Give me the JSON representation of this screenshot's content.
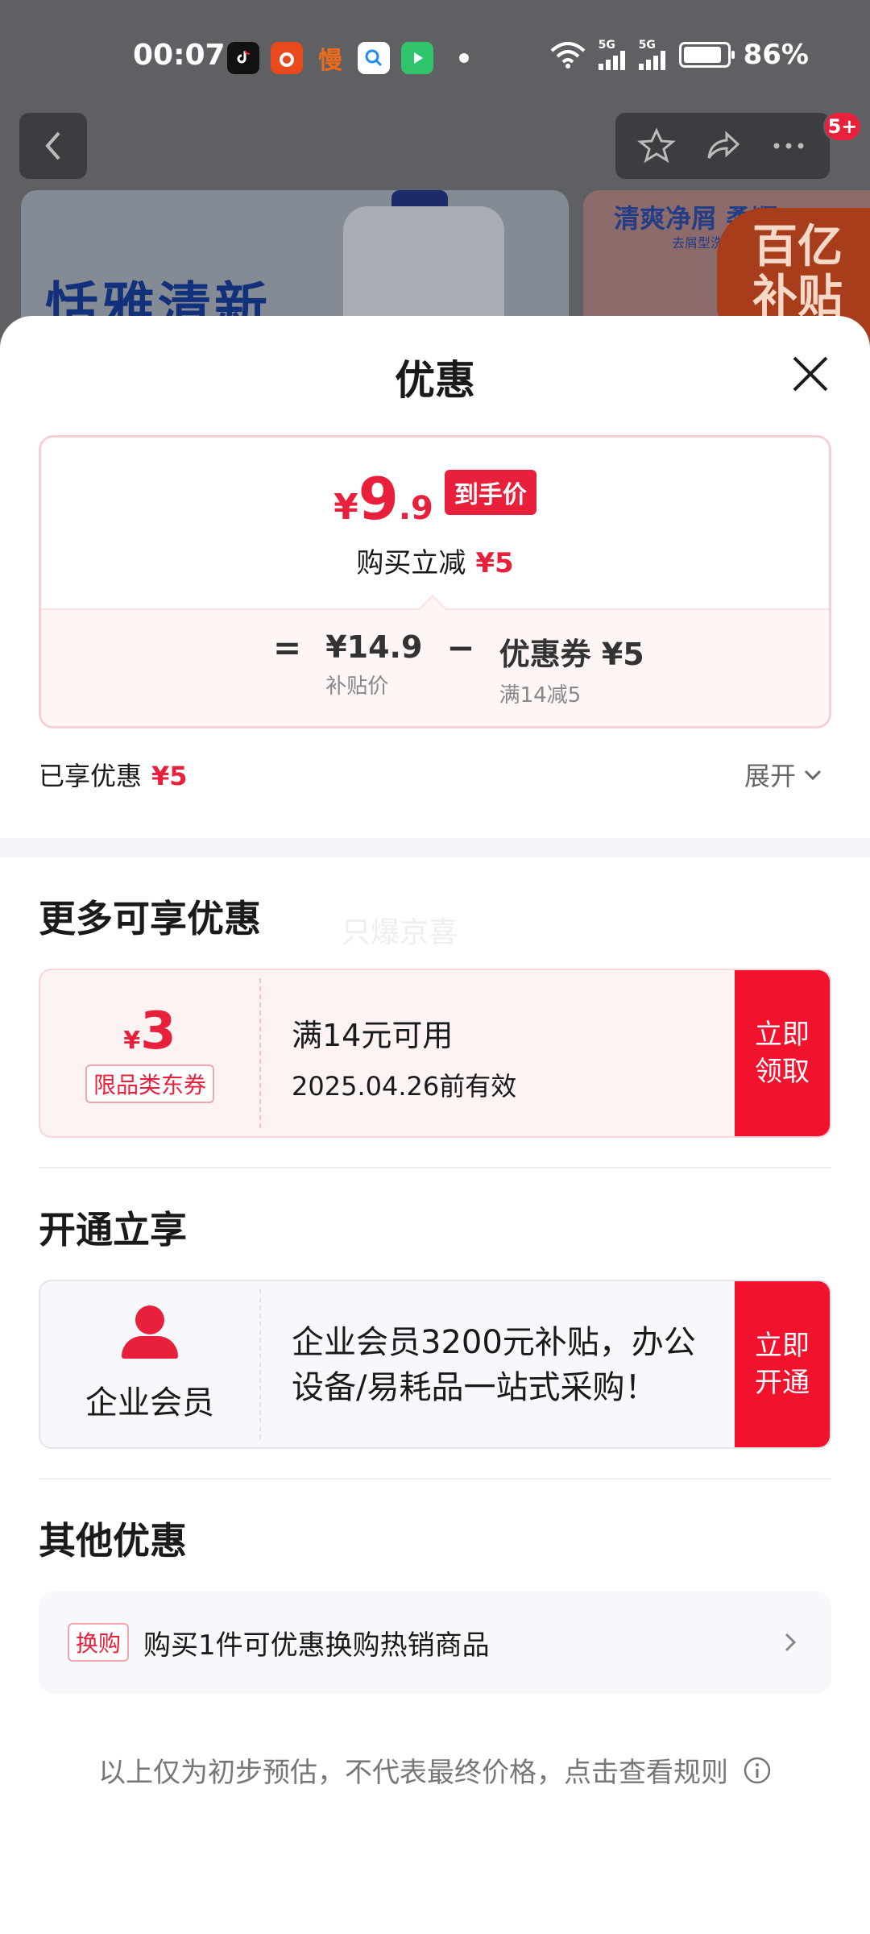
{
  "status_bar": {
    "time": "00:07",
    "battery_percent": "86%",
    "signal_1": "5G",
    "signal_2": "5G",
    "apps": [
      "tiktok-app-icon",
      "shopping-app-icon",
      "slow-app-icon",
      "search-app-icon",
      "video-app-icon"
    ],
    "slow_app_glyph": "慢"
  },
  "background_page": {
    "banner_left_text": "恬雅清新",
    "banner_right_text": "清爽净屑 柔顺",
    "banner_right_sub": "去屑型洗",
    "subsidy_badge_line1": "百亿",
    "subsidy_badge_line2": "补贴",
    "nav_badge": "5+"
  },
  "sheet": {
    "title": "优惠",
    "final_price": {
      "yen": "¥",
      "integer": "9",
      "decimal": ".9",
      "tag": "到手价"
    },
    "instant_discount": {
      "label": "购买立减",
      "value": "¥5"
    },
    "formula": {
      "equals": "=",
      "minus": "−",
      "subsidy_price": "¥14.9",
      "subsidy_price_label": "补贴价",
      "coupon_value": "优惠券 ¥5",
      "coupon_condition": "满14减5"
    },
    "enjoyed": {
      "label": "已享优惠",
      "value": "¥5"
    },
    "expand_label": "展开",
    "more_section": {
      "title": "更多可享优惠",
      "watermark": "只爆京喜",
      "coupon": {
        "yen": "¥",
        "amount": "3",
        "type": "限品类东券",
        "condition": "满14元可用",
        "expiry": "2025.04.26前有效",
        "button": "立即领取"
      }
    },
    "member_section": {
      "title": "开通立享",
      "label": "企业会员",
      "description": "企业会员3200元补贴，办公设备/易耗品一站式采购！",
      "button": "立即开通"
    },
    "other_section": {
      "title": "其他优惠",
      "tag": "换购",
      "text": "购买1件可优惠换购热销商品"
    },
    "disclaimer": "以上仅为初步预估，不代表最终价格，点击查看规则"
  },
  "colors": {
    "accent_red": "#e8203b",
    "button_red": "#f2122e",
    "coupon_bg": "#fdf3f3",
    "member_bg": "#f7f8fb"
  }
}
